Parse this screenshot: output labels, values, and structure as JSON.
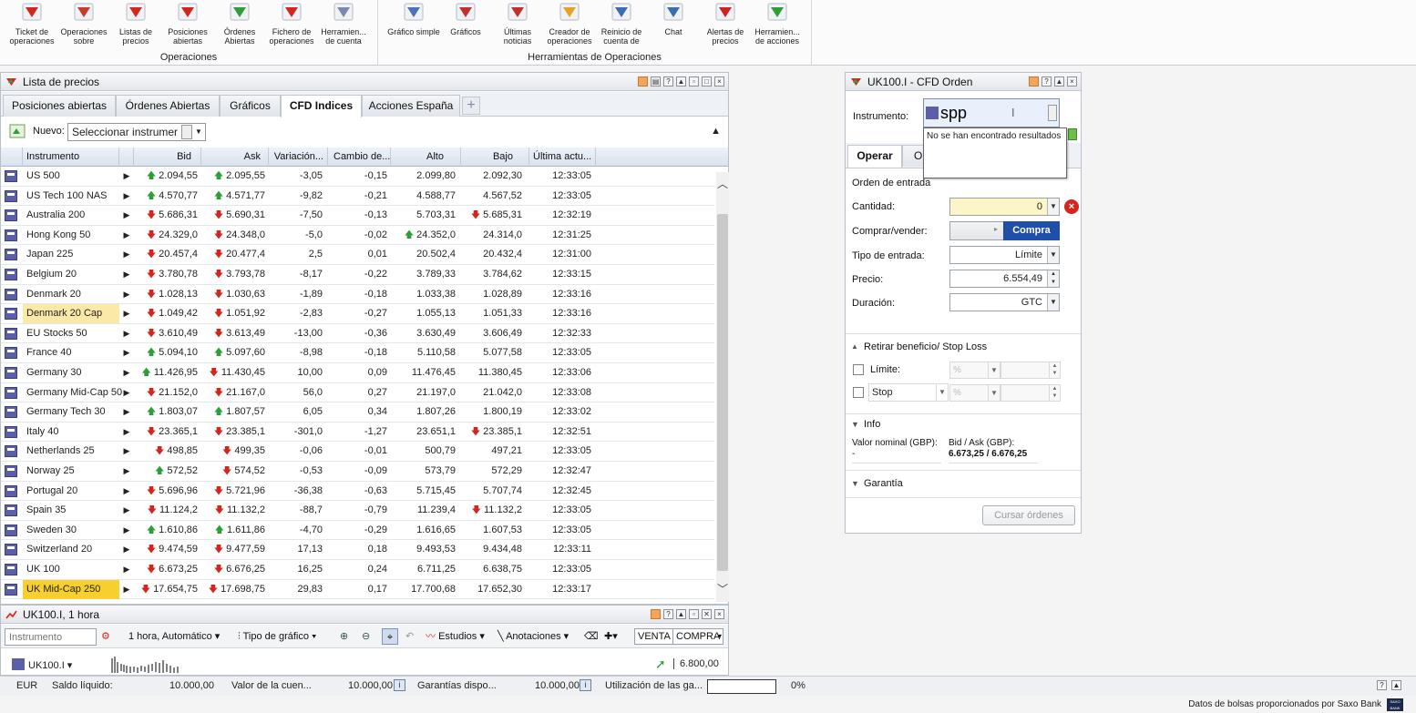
{
  "ribbon": {
    "groups": [
      {
        "title": "Operaciones",
        "buttons": [
          {
            "label": "Ticket de operaciones",
            "icon": "ticket-icon"
          },
          {
            "label": "Operaciones sobre",
            "icon": "fx-operations-icon"
          },
          {
            "label": "Listas de precios",
            "icon": "price-lists-icon"
          },
          {
            "label": "Posiciones abiertas",
            "icon": "open-positions-icon"
          },
          {
            "label": "Órdenes Abiertas",
            "icon": "open-orders-icon"
          },
          {
            "label": "Fichero de operaciones",
            "icon": "trade-file-icon"
          },
          {
            "label": "Herramien... de cuenta",
            "icon": "account-tools-icon"
          }
        ]
      },
      {
        "title": "Herramientas de Operaciones",
        "buttons": [
          {
            "label": "Gráfico simple",
            "icon": "simple-chart-icon"
          },
          {
            "label": "Gráficos",
            "icon": "charts-icon"
          },
          {
            "label": "Últimas noticias",
            "icon": "news-icon"
          },
          {
            "label": "Creador de operaciones",
            "icon": "trade-creator-icon"
          },
          {
            "label": "Reinicio de cuenta de",
            "icon": "account-reset-icon"
          },
          {
            "label": "Chat",
            "icon": "chat-icon"
          },
          {
            "label": "Alertas de precios",
            "icon": "price-alerts-icon"
          },
          {
            "label": "Herramien... de acciones",
            "icon": "stock-tools-icon"
          }
        ]
      }
    ]
  },
  "pricelist": {
    "title": "Lista de precios",
    "tabs": [
      "Posiciones abiertas",
      "Órdenes Abiertas",
      "Gráficos",
      "CFD Indices",
      "Acciones España"
    ],
    "active_tab": "CFD Indices",
    "nuevo_label": "Nuevo:",
    "instrument_select": "Seleccionar instrumer",
    "columns": [
      "Instrumento",
      "Bid",
      "Ask",
      "Variación...",
      "Cambio de...",
      "Alto",
      "Bajo",
      "Última actu..."
    ],
    "rows": [
      {
        "name": "US 500",
        "bid": "2.094,55",
        "bid_dir": "up",
        "ask": "2.095,55",
        "ask_dir": "up",
        "var": "-3,05",
        "chg": "-0,15",
        "high": "2.099,80",
        "high_dir": "",
        "low": "2.092,30",
        "low_dir": "",
        "time": "12:33:05",
        "hl": ""
      },
      {
        "name": "US Tech 100 NAS",
        "bid": "4.570,77",
        "bid_dir": "up",
        "ask": "4.571,77",
        "ask_dir": "up",
        "var": "-9,82",
        "chg": "-0,21",
        "high": "4.588,77",
        "high_dir": "",
        "low": "4.567,52",
        "low_dir": "",
        "time": "12:33:05",
        "hl": ""
      },
      {
        "name": "Australia 200",
        "bid": "5.686,31",
        "bid_dir": "down",
        "ask": "5.690,31",
        "ask_dir": "down",
        "var": "-7,50",
        "chg": "-0,13",
        "high": "5.703,31",
        "high_dir": "",
        "low": "5.685,31",
        "low_dir": "down",
        "time": "12:32:19",
        "hl": ""
      },
      {
        "name": "Hong Kong 50",
        "bid": "24.329,0",
        "bid_dir": "down",
        "ask": "24.348,0",
        "ask_dir": "down",
        "var": "-5,0",
        "chg": "-0,02",
        "high": "24.352,0",
        "high_dir": "up",
        "low": "24.314,0",
        "low_dir": "",
        "time": "12:31:25",
        "hl": ""
      },
      {
        "name": "Japan 225",
        "bid": "20.457,4",
        "bid_dir": "down",
        "ask": "20.477,4",
        "ask_dir": "down",
        "var": "2,5",
        "chg": "0,01",
        "high": "20.502,4",
        "high_dir": "",
        "low": "20.432,4",
        "low_dir": "",
        "time": "12:31:00",
        "hl": ""
      },
      {
        "name": "Belgium 20",
        "bid": "3.780,78",
        "bid_dir": "down",
        "ask": "3.793,78",
        "ask_dir": "down",
        "var": "-8,17",
        "chg": "-0,22",
        "high": "3.789,33",
        "high_dir": "",
        "low": "3.784,62",
        "low_dir": "",
        "time": "12:33:15",
        "hl": ""
      },
      {
        "name": "Denmark 20",
        "bid": "1.028,13",
        "bid_dir": "down",
        "ask": "1.030,63",
        "ask_dir": "down",
        "var": "-1,89",
        "chg": "-0,18",
        "high": "1.033,38",
        "high_dir": "",
        "low": "1.028,89",
        "low_dir": "",
        "time": "12:33:16",
        "hl": ""
      },
      {
        "name": "Denmark 20 Cap",
        "bid": "1.049,42",
        "bid_dir": "down",
        "ask": "1.051,92",
        "ask_dir": "down",
        "var": "-2,83",
        "chg": "-0,27",
        "high": "1.055,13",
        "high_dir": "",
        "low": "1.051,33",
        "low_dir": "",
        "time": "12:33:16",
        "hl": "light"
      },
      {
        "name": "EU Stocks 50",
        "bid": "3.610,49",
        "bid_dir": "down",
        "ask": "3.613,49",
        "ask_dir": "down",
        "var": "-13,00",
        "chg": "-0,36",
        "high": "3.630,49",
        "high_dir": "",
        "low": "3.606,49",
        "low_dir": "",
        "time": "12:32:33",
        "hl": ""
      },
      {
        "name": "France 40",
        "bid": "5.094,10",
        "bid_dir": "up",
        "ask": "5.097,60",
        "ask_dir": "up",
        "var": "-8,98",
        "chg": "-0,18",
        "high": "5.110,58",
        "high_dir": "",
        "low": "5.077,58",
        "low_dir": "",
        "time": "12:33:05",
        "hl": ""
      },
      {
        "name": "Germany 30",
        "bid": "11.426,95",
        "bid_dir": "up",
        "ask": "11.430,45",
        "ask_dir": "down",
        "var": "10,00",
        "chg": "0,09",
        "high": "11.476,45",
        "high_dir": "",
        "low": "11.380,45",
        "low_dir": "",
        "time": "12:33:06",
        "hl": ""
      },
      {
        "name": "Germany Mid-Cap 50",
        "bid": "21.152,0",
        "bid_dir": "down",
        "ask": "21.167,0",
        "ask_dir": "down",
        "var": "56,0",
        "chg": "0,27",
        "high": "21.197,0",
        "high_dir": "",
        "low": "21.042,0",
        "low_dir": "",
        "time": "12:33:08",
        "hl": ""
      },
      {
        "name": "Germany Tech 30",
        "bid": "1.803,07",
        "bid_dir": "up",
        "ask": "1.807,57",
        "ask_dir": "up",
        "var": "6,05",
        "chg": "0,34",
        "high": "1.807,26",
        "high_dir": "",
        "low": "1.800,19",
        "low_dir": "",
        "time": "12:33:02",
        "hl": ""
      },
      {
        "name": "Italy 40",
        "bid": "23.365,1",
        "bid_dir": "down",
        "ask": "23.385,1",
        "ask_dir": "down",
        "var": "-301,0",
        "chg": "-1,27",
        "high": "23.651,1",
        "high_dir": "",
        "low": "23.385,1",
        "low_dir": "down",
        "time": "12:32:51",
        "hl": ""
      },
      {
        "name": "Netherlands 25",
        "bid": "498,85",
        "bid_dir": "down",
        "ask": "499,35",
        "ask_dir": "down",
        "var": "-0,06",
        "chg": "-0,01",
        "high": "500,79",
        "high_dir": "",
        "low": "497,21",
        "low_dir": "",
        "time": "12:33:05",
        "hl": ""
      },
      {
        "name": "Norway 25",
        "bid": "572,52",
        "bid_dir": "up",
        "ask": "574,52",
        "ask_dir": "down",
        "var": "-0,53",
        "chg": "-0,09",
        "high": "573,79",
        "high_dir": "",
        "low": "572,29",
        "low_dir": "",
        "time": "12:32:47",
        "hl": ""
      },
      {
        "name": "Portugal 20",
        "bid": "5.696,96",
        "bid_dir": "down",
        "ask": "5.721,96",
        "ask_dir": "down",
        "var": "-36,38",
        "chg": "-0,63",
        "high": "5.715,45",
        "high_dir": "",
        "low": "5.707,74",
        "low_dir": "",
        "time": "12:32:45",
        "hl": ""
      },
      {
        "name": "Spain 35",
        "bid": "11.124,2",
        "bid_dir": "down",
        "ask": "11.132,2",
        "ask_dir": "down",
        "var": "-88,7",
        "chg": "-0,79",
        "high": "11.239,4",
        "high_dir": "",
        "low": "11.132,2",
        "low_dir": "down",
        "time": "12:33:05",
        "hl": ""
      },
      {
        "name": "Sweden 30",
        "bid": "1.610,86",
        "bid_dir": "up",
        "ask": "1.611,86",
        "ask_dir": "up",
        "var": "-4,70",
        "chg": "-0,29",
        "high": "1.616,65",
        "high_dir": "",
        "low": "1.607,53",
        "low_dir": "",
        "time": "12:33:05",
        "hl": ""
      },
      {
        "name": "Switzerland 20",
        "bid": "9.474,59",
        "bid_dir": "down",
        "ask": "9.477,59",
        "ask_dir": "down",
        "var": "17,13",
        "chg": "0,18",
        "high": "9.493,53",
        "high_dir": "",
        "low": "9.434,48",
        "low_dir": "",
        "time": "12:33:11",
        "hl": ""
      },
      {
        "name": "UK 100",
        "bid": "6.673,25",
        "bid_dir": "down",
        "ask": "6.676,25",
        "ask_dir": "down",
        "var": "16,25",
        "chg": "0,24",
        "high": "6.711,25",
        "high_dir": "",
        "low": "6.638,75",
        "low_dir": "",
        "time": "12:33:05",
        "hl": ""
      },
      {
        "name": "UK Mid-Cap 250",
        "bid": "17.654,75",
        "bid_dir": "down",
        "ask": "17.698,75",
        "ask_dir": "down",
        "var": "29,83",
        "chg": "0,17",
        "high": "17.700,68",
        "high_dir": "",
        "low": "17.652,30",
        "low_dir": "",
        "time": "12:33:17",
        "hl": "strong"
      }
    ]
  },
  "chart": {
    "title": "UK100.I, 1 hora",
    "instrument_placeholder": "Instrumento",
    "interval": "1 hora, Automático",
    "chart_type": "Tipo de gráfico",
    "studies": "Estudios",
    "annotations": "Anotaciones",
    "sell": "VENTA",
    "buy": "COMPRA",
    "symbol": "UK100.I",
    "price_label": "6.800,00"
  },
  "order": {
    "title": "UK100.I - CFD Orden",
    "instrument_label": "Instrumento:",
    "instrument_value": "spp",
    "no_results": "No se han encontrado resultados",
    "tabs": [
      "Operar",
      "Or"
    ],
    "entry_section": "Orden de entrada",
    "quantity_label": "Cantidad:",
    "quantity_value": "0",
    "buysell_label": "Comprar/vender:",
    "buy_button": "Compra",
    "entry_type_label": "Tipo de entrada:",
    "entry_type_value": "Límite",
    "price_label": "Precio:",
    "price_value": "6.554,49",
    "duration_label": "Duración:",
    "duration_value": "GTC",
    "tpsl_section": "Retirar beneficio/ Stop Loss",
    "limit_label": "Límite:",
    "stop_label": "Stop",
    "pct": "%",
    "info_section": "Info",
    "nominal_label": "Valor nominal (GBP):",
    "nominal_value": "-",
    "bidask_label": "Bid / Ask (GBP):",
    "bid_value": "6.673,25",
    "bidask_sep": " / ",
    "ask_value": "6.676,25",
    "guarantee_section": "Garantía",
    "submit": "Cursar órdenes"
  },
  "status": {
    "currency": "EUR",
    "cash_label": "Saldo líquido:",
    "cash_value": "10.000,00",
    "account_label": "Valor de la cuen...",
    "account_value": "10.000,00",
    "margin_label": "Garantías dispo...",
    "margin_value": "10.000,00",
    "usage_label": "Utilización de las ga...",
    "usage_pct": "0%",
    "usage_fraction": 0
  },
  "footer": {
    "text": "Datos de bolsas proporcionados por Saxo Bank",
    "logo": "SAXO BANK"
  },
  "colors": {
    "up": "#2f9e3a",
    "down": "#d3261f",
    "buy": "#1f4fa8",
    "hl_light": "#fbe9a8",
    "hl_strong": "#f7cf2e"
  }
}
